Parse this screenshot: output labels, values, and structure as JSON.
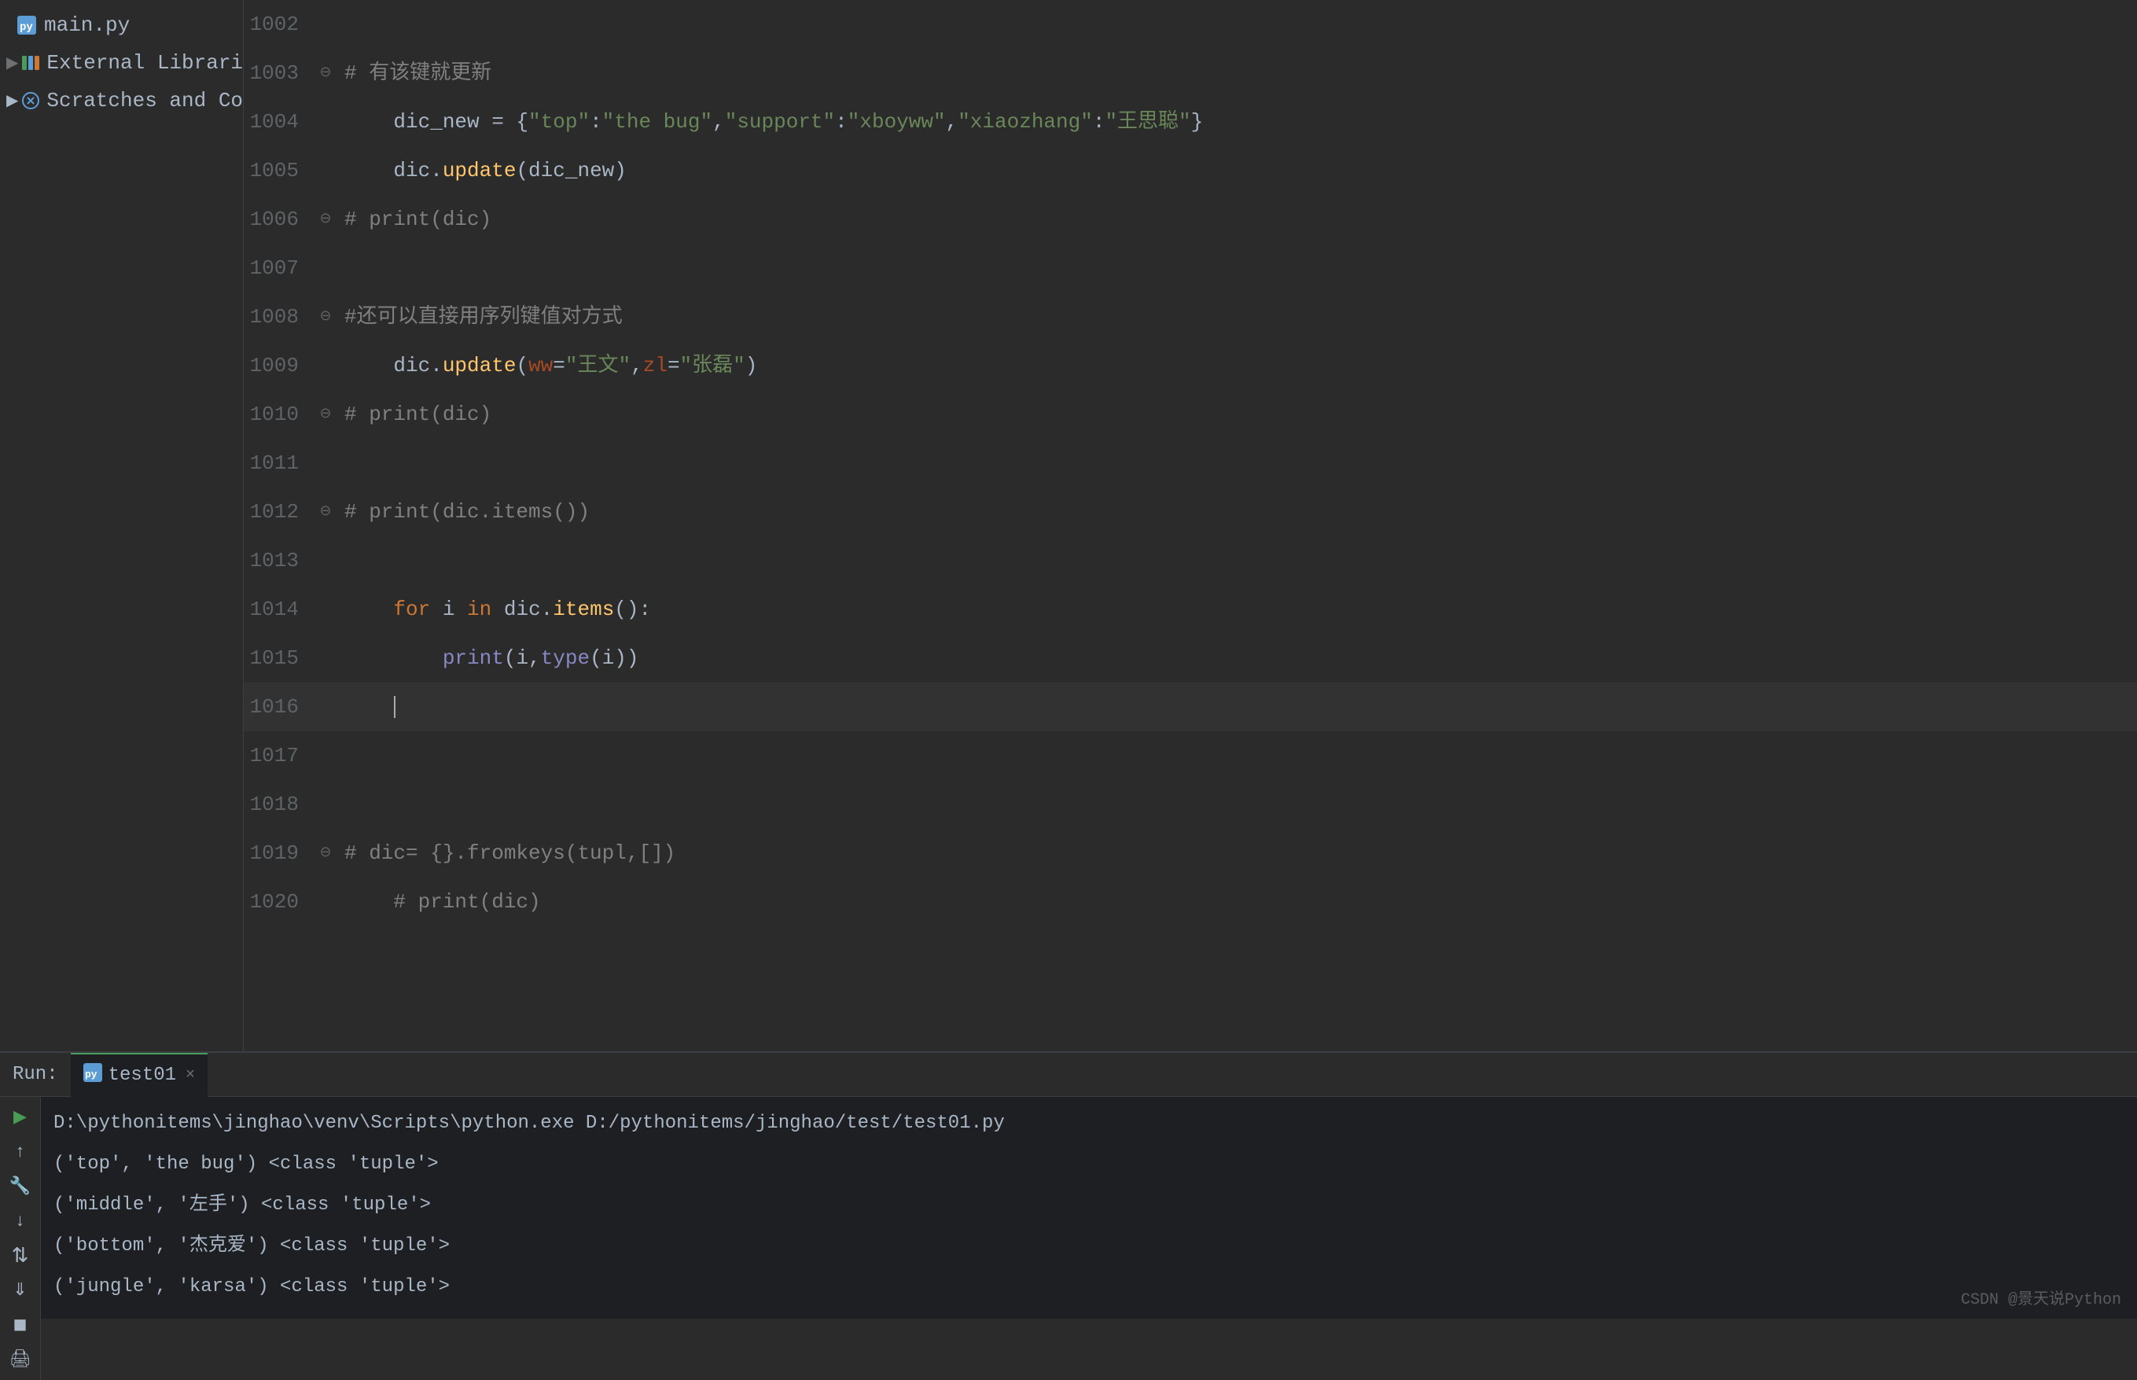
{
  "sidebar": {
    "items": [
      {
        "id": "main-py",
        "label": "main.py",
        "icon": "python-file",
        "indent": 1,
        "has_arrow": false
      },
      {
        "id": "external-libraries",
        "label": "External Libraries",
        "icon": "library",
        "indent": 0,
        "has_arrow": true
      },
      {
        "id": "scratches",
        "label": "Scratches and Consoles",
        "icon": "scratches",
        "indent": 0,
        "has_arrow": false
      }
    ]
  },
  "editor": {
    "lines": [
      {
        "num": "1002",
        "fold": "",
        "text": "",
        "tokens": []
      },
      {
        "num": "1003",
        "fold": "⊖",
        "text": "# 有该键就更新",
        "type": "comment"
      },
      {
        "num": "1004",
        "fold": "",
        "text": "    dic_new = {\"top\":\"the bug\",\"support\":\"xboyww\",\"xiaozhang\":\"王思聪\"}",
        "type": "code"
      },
      {
        "num": "1005",
        "fold": "",
        "text": "    dic.update(dic_new)",
        "type": "code"
      },
      {
        "num": "1006",
        "fold": "⊖",
        "text": "# print(dic)",
        "type": "comment"
      },
      {
        "num": "1007",
        "fold": "",
        "text": "",
        "type": "empty"
      },
      {
        "num": "1008",
        "fold": "⊖",
        "text": "#还可以直接用序列键值对方式",
        "type": "comment"
      },
      {
        "num": "1009",
        "fold": "",
        "text": "    dic.update(ww=\"王文\",zl=\"张磊\")",
        "type": "code"
      },
      {
        "num": "1010",
        "fold": "⊖",
        "text": "# print(dic)",
        "type": "comment"
      },
      {
        "num": "1011",
        "fold": "",
        "text": "",
        "type": "empty"
      },
      {
        "num": "1012",
        "fold": "⊖",
        "text": "# print(dic.items())",
        "type": "comment"
      },
      {
        "num": "1013",
        "fold": "",
        "text": "",
        "type": "empty"
      },
      {
        "num": "1014",
        "fold": "",
        "text": "    for i in dic.items():",
        "type": "for"
      },
      {
        "num": "1015",
        "fold": "",
        "text": "        print(i,type(i))",
        "type": "print"
      },
      {
        "num": "1016",
        "fold": "",
        "text": "",
        "type": "cursor"
      },
      {
        "num": "1017",
        "fold": "",
        "text": "",
        "type": "empty"
      },
      {
        "num": "1018",
        "fold": "",
        "text": "",
        "type": "empty"
      },
      {
        "num": "1019",
        "fold": "⊖",
        "text": "# dic= {}.fromkeys(tupl,[])",
        "type": "comment"
      },
      {
        "num": "1020",
        "fold": "",
        "text": "    # print(dic)",
        "type": "comment"
      }
    ]
  },
  "run_panel": {
    "label": "Run:",
    "tab_name": "test01",
    "tab_close": "×",
    "console_output": [
      {
        "text": "D:\\pythonitems\\jinghao\\venv\\Scripts\\python.exe D:/pythonitems/jinghao/test/test01.py",
        "type": "command"
      },
      {
        "text": "('top', 'the bug') <class 'tuple'>",
        "type": "output"
      },
      {
        "text": "('middle', '左手') <class 'tuple'>",
        "type": "output"
      },
      {
        "text": "('bottom', '杰克爱') <class 'tuple'>",
        "type": "output"
      },
      {
        "text": "('jungle', 'karsa') <class 'tuple'>",
        "type": "output"
      }
    ],
    "toolbar_buttons": [
      {
        "id": "play",
        "icon": "▶",
        "color": "green"
      },
      {
        "id": "scroll-up",
        "icon": "↑",
        "color": "normal"
      },
      {
        "id": "wrench",
        "icon": "🔧",
        "color": "normal"
      },
      {
        "id": "scroll-down",
        "icon": "↓",
        "color": "normal"
      },
      {
        "id": "rerun",
        "icon": "↻",
        "color": "normal"
      },
      {
        "id": "scroll-end",
        "icon": "⇓",
        "color": "normal"
      },
      {
        "id": "stop",
        "icon": "⏹",
        "color": "normal"
      },
      {
        "id": "print",
        "icon": "🖨",
        "color": "normal"
      }
    ]
  },
  "watermark": {
    "text": "CSDN @景天说Python"
  }
}
